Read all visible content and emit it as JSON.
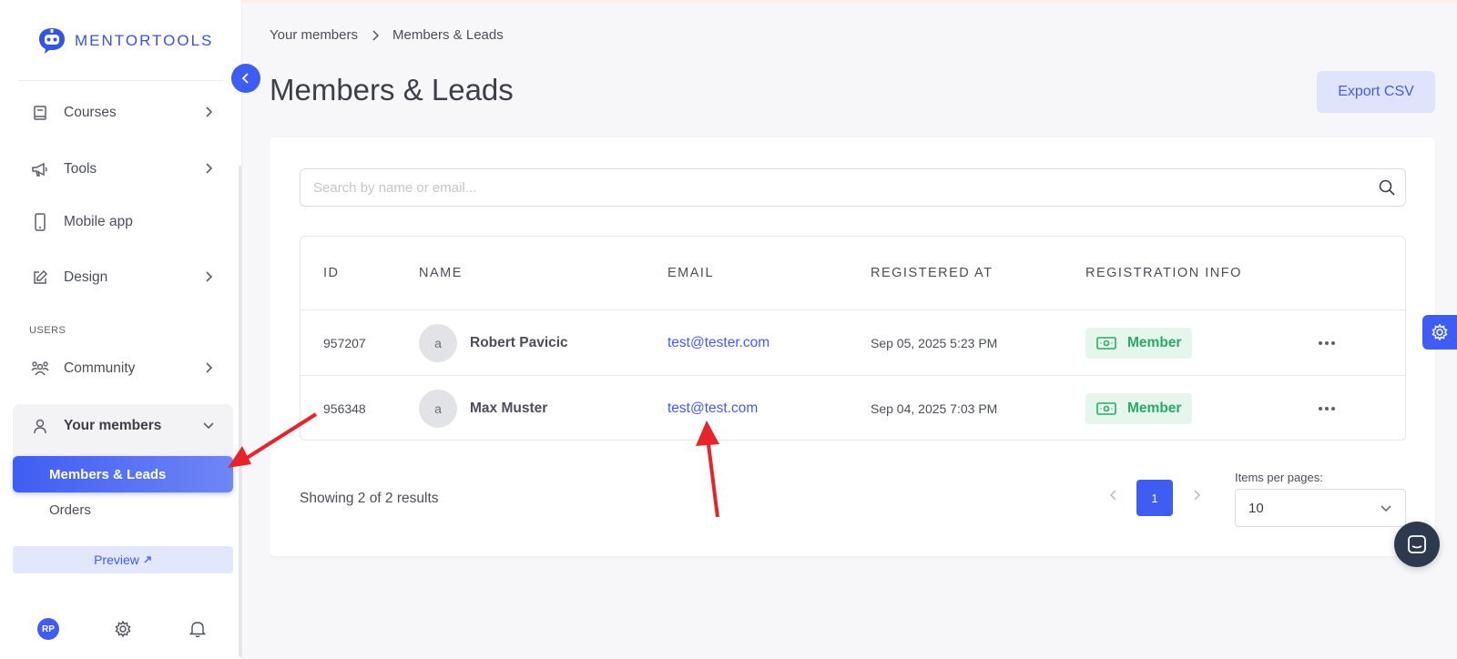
{
  "app": {
    "brand": "MENTORTOOLS"
  },
  "sidebar": {
    "items": [
      {
        "label": "Courses"
      },
      {
        "label": "Tools"
      },
      {
        "label": "Mobile app"
      },
      {
        "label": "Design"
      }
    ],
    "section_label": "USERS",
    "community": {
      "label": "Community"
    },
    "members_group": {
      "label": "Your members",
      "sub_items": [
        {
          "label": "Members & Leads",
          "active": true
        },
        {
          "label": "Orders",
          "active": false
        }
      ]
    },
    "preview_label": "Preview",
    "footer": {
      "avatar_initials": "RP"
    }
  },
  "breadcrumb": {
    "parent": "Your members",
    "current": "Members & Leads"
  },
  "page": {
    "title": "Members & Leads",
    "export_label": "Export CSV"
  },
  "search": {
    "placeholder": "Search by name or email..."
  },
  "table": {
    "headers": {
      "id": "ID",
      "name": "NAME",
      "email": "EMAIL",
      "registered": "REGISTERED AT",
      "info": "REGISTRATION INFO"
    },
    "rows": [
      {
        "id": "957207",
        "avatar": "a",
        "name": "Robert Pavicic",
        "email": "test@tester.com",
        "registered": "Sep 05, 2025 5:23 PM",
        "badge": "Member"
      },
      {
        "id": "956348",
        "avatar": "a",
        "name": "Max Muster",
        "email": "test@test.com",
        "registered": "Sep 04, 2025 7:03 PM",
        "badge": "Member"
      }
    ]
  },
  "pagination": {
    "showing": "Showing 2 of 2 results",
    "current_page": "1",
    "items_per_page_label": "Items per pages:",
    "items_per_page_value": "10"
  },
  "colors": {
    "accent": "#3f5df2",
    "member_badge_bg": "#e5f6ec",
    "member_badge_text": "#2aa866",
    "annotation_arrow": "#e8232a"
  }
}
